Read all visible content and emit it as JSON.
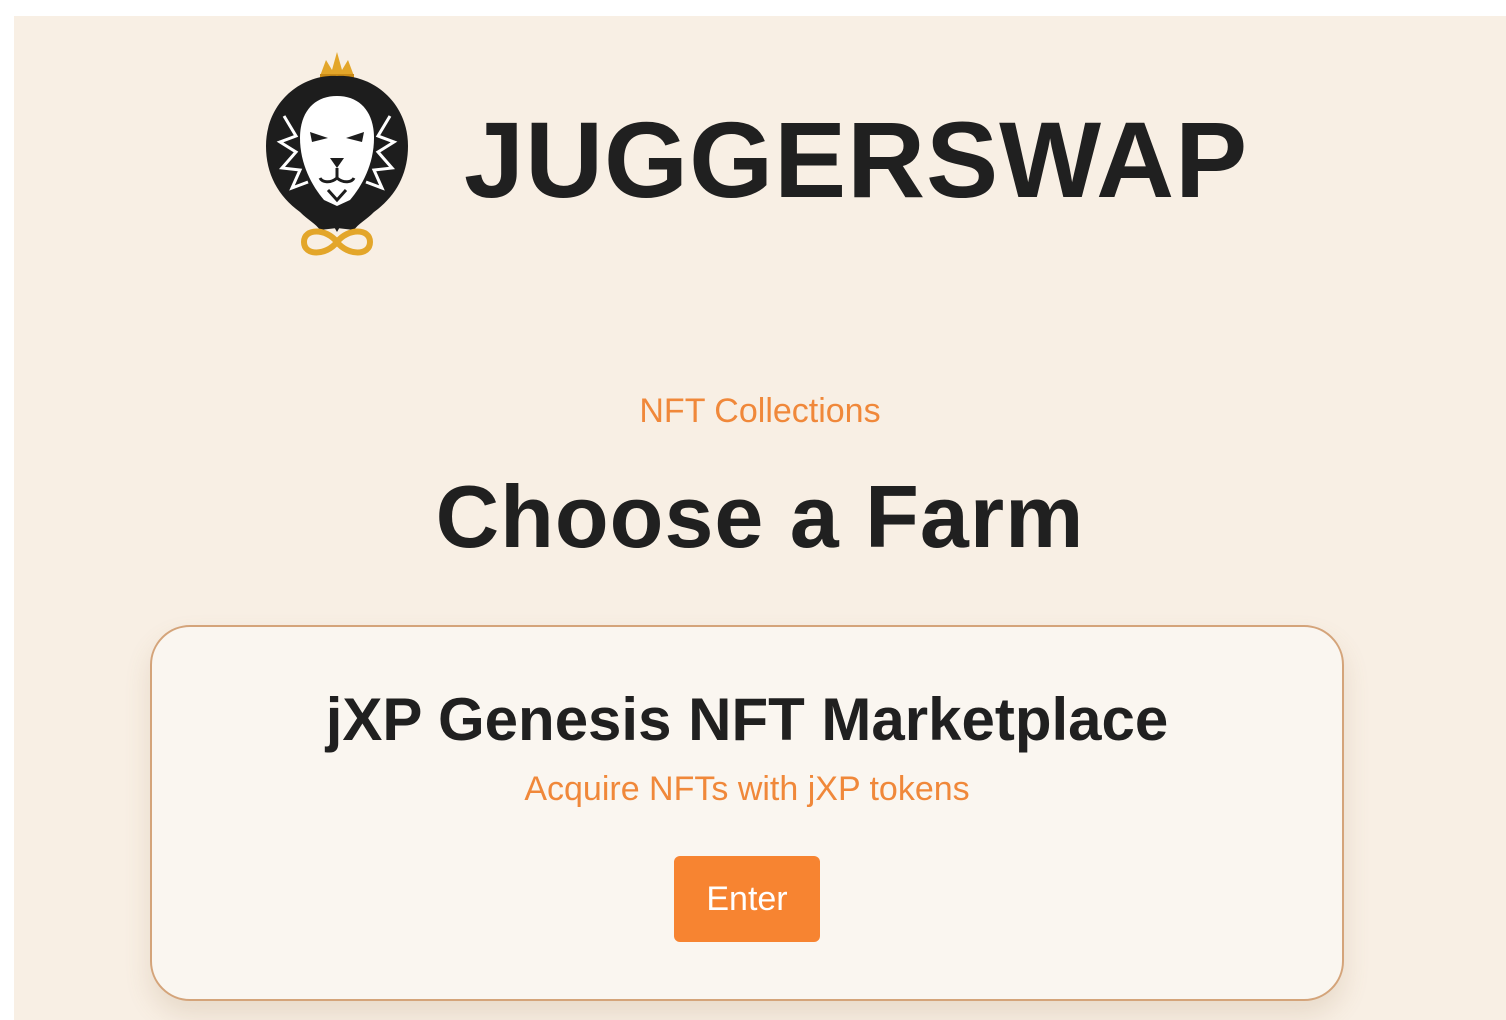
{
  "header": {
    "brand": "JUGGERSWAP",
    "logo_icon": "lion-crown-infinity-icon"
  },
  "section": {
    "eyebrow": "NFT Collections",
    "heading": "Choose a Farm"
  },
  "card": {
    "title": "jXP Genesis NFT Marketplace",
    "subtitle": "Acquire NFTs with jXP tokens",
    "button_label": "Enter"
  },
  "colors": {
    "background": "#f8efe4",
    "accent": "#f78431",
    "accent_text": "#f0883a",
    "text": "#202020",
    "card_border": "#d4a47a"
  }
}
